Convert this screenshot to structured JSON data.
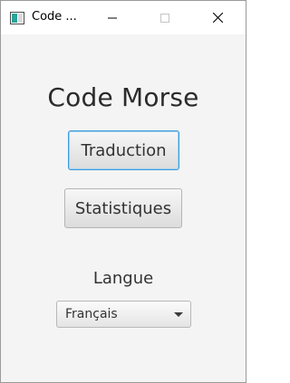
{
  "window": {
    "title": "Code ...",
    "controls": {
      "minimize_icon": "minimize-icon",
      "maximize_icon": "maximize-icon",
      "close_icon": "close-icon"
    }
  },
  "main": {
    "title": "Code Morse",
    "translate_button": "Traduction",
    "stats_button": "Statistiques",
    "language_label": "Langue",
    "language_select": {
      "selected": "Français"
    }
  },
  "colors": {
    "window_bg": "#f4f4f4",
    "titlebar_bg": "#ffffff",
    "focus_border": "#3c9bd8"
  }
}
